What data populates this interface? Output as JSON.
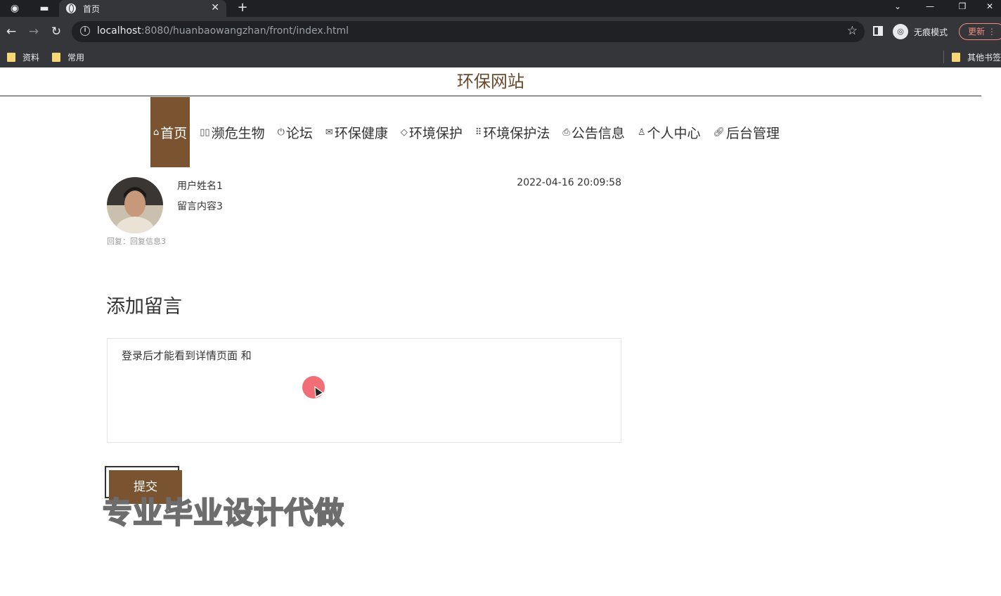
{
  "browser": {
    "tab_title": "首页",
    "url_host": "localhost",
    "url_rest": ":8080/huanbaowangzhan/front/index.html",
    "incognito_label": "无痕模式",
    "update_label": "更新",
    "bookmarks": [
      "资料",
      "常用"
    ],
    "other_bookmarks": "其他书签"
  },
  "site": {
    "title": "环保网站"
  },
  "nav": {
    "items": [
      {
        "label": "首页",
        "icon": "home-icon"
      },
      {
        "label": "濒危生物",
        "icon": "grid-icon"
      },
      {
        "label": "论坛",
        "icon": "power-icon"
      },
      {
        "label": "环保健康",
        "icon": "mail-icon"
      },
      {
        "label": "环境保护",
        "icon": "tag-icon"
      },
      {
        "label": "环境保护法",
        "icon": "apps-icon"
      },
      {
        "label": "公告信息",
        "icon": "print-icon"
      },
      {
        "label": "个人中心",
        "icon": "user-icon"
      },
      {
        "label": "后台管理",
        "icon": "link-icon"
      }
    ]
  },
  "comment": {
    "username": "用户姓名1",
    "content": "留言内容3",
    "time": "2022-04-16 20:09:58",
    "reply": "回复：回复信息3"
  },
  "add_comment": {
    "title": "添加留言",
    "textarea_value": "登录后才能看到详情页面 和",
    "submit_label": "提交"
  },
  "watermark": "专业毕业设计代做"
}
